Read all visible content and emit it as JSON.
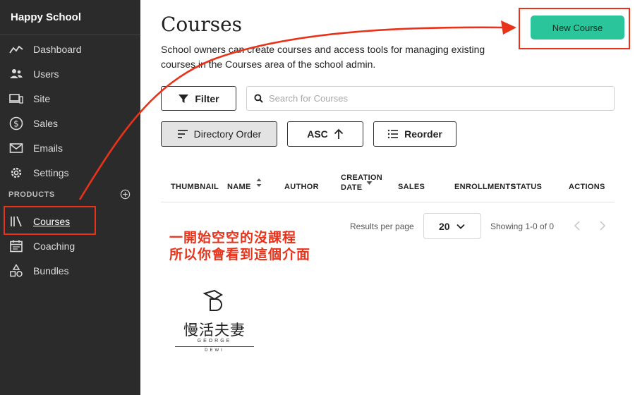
{
  "sidebar": {
    "brand": "Happy School",
    "items": [
      {
        "label": "Dashboard",
        "icon": "trend-line-icon"
      },
      {
        "label": "Users",
        "icon": "users-icon"
      },
      {
        "label": "Site",
        "icon": "devices-icon"
      },
      {
        "label": "Sales",
        "icon": "dollar-circle-icon"
      },
      {
        "label": "Emails",
        "icon": "envelope-icon"
      },
      {
        "label": "Settings",
        "icon": "gear-icon"
      }
    ],
    "section_label": "PRODUCTS",
    "products": [
      {
        "label": "Courses",
        "icon": "library-icon",
        "active": true
      },
      {
        "label": "Coaching",
        "icon": "calendar-icon"
      },
      {
        "label": "Bundles",
        "icon": "shapes-icon"
      }
    ]
  },
  "main": {
    "title": "Courses",
    "description": "School owners can create courses and access tools for managing existing courses in the Courses area of the school admin.",
    "new_course_label": "New Course",
    "filter_label": "Filter",
    "search_placeholder": "Search for Courses",
    "directory_order_label": "Directory Order",
    "asc_label": "ASC",
    "reorder_label": "Reorder",
    "columns": [
      "THUMBNAIL",
      "NAME",
      "AUTHOR",
      "CREATION DATE",
      "SALES",
      "ENROLLMENTS",
      "STATUS",
      "ACTIONS"
    ],
    "pagination": {
      "results_label": "Results per page",
      "per_page": "20",
      "showing": "Showing 1-0 of 0"
    }
  },
  "annotation": {
    "line1": "一開始空空的沒課程",
    "line2": "所以你會看到這個介面",
    "color": "#e8321a"
  },
  "logo": {
    "title": "慢活夫妻",
    "sub1": "GEORGE",
    "sub2": "DEWI"
  },
  "colors": {
    "sidebar_bg": "#2b2b2b",
    "accent_green": "#2ac59a"
  }
}
